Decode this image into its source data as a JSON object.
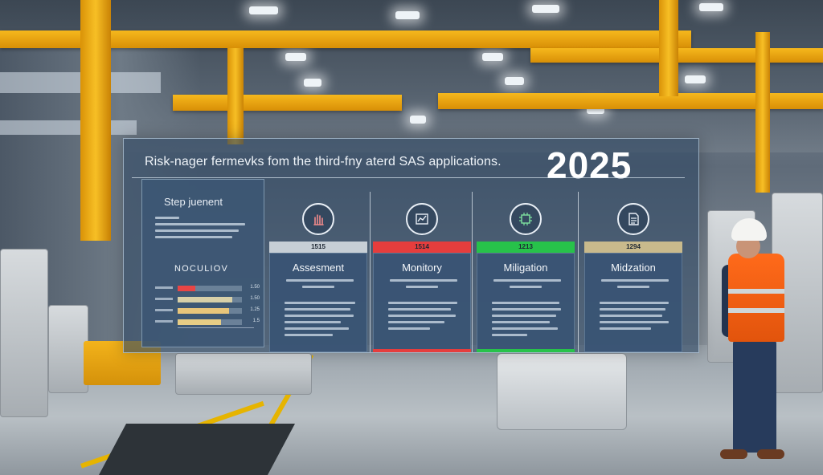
{
  "panel": {
    "title": "Risk-nager fermevks fom the third-fny aterd SAS applications.",
    "year": "2025"
  },
  "step_panel": {
    "title": "Step juenent",
    "subtitle": "NOCULIOV",
    "bars": [
      {
        "fill": 0.27,
        "color": "#e84545",
        "value": "1.50"
      },
      {
        "fill": 0.85,
        "color": "#d8d0a8",
        "value": "1.50"
      },
      {
        "fill": 0.8,
        "color": "#e8c57a",
        "value": "1.25"
      },
      {
        "fill": 0.68,
        "color": "#e6cc85",
        "value": "1.5"
      }
    ]
  },
  "phases": [
    {
      "icon": "hand-icon",
      "code": "1515",
      "name": "Assesment",
      "color": "#c7cfd6"
    },
    {
      "icon": "chart-icon",
      "code": "1514",
      "name": "Monitory",
      "color": "#e53d3d"
    },
    {
      "icon": "circuit-icon",
      "code": "1213",
      "name": "Miligation",
      "color": "#27c24a"
    },
    {
      "icon": "document-icon",
      "code": "1294",
      "name": "Midzation",
      "color": "#c9ba8c"
    }
  ]
}
